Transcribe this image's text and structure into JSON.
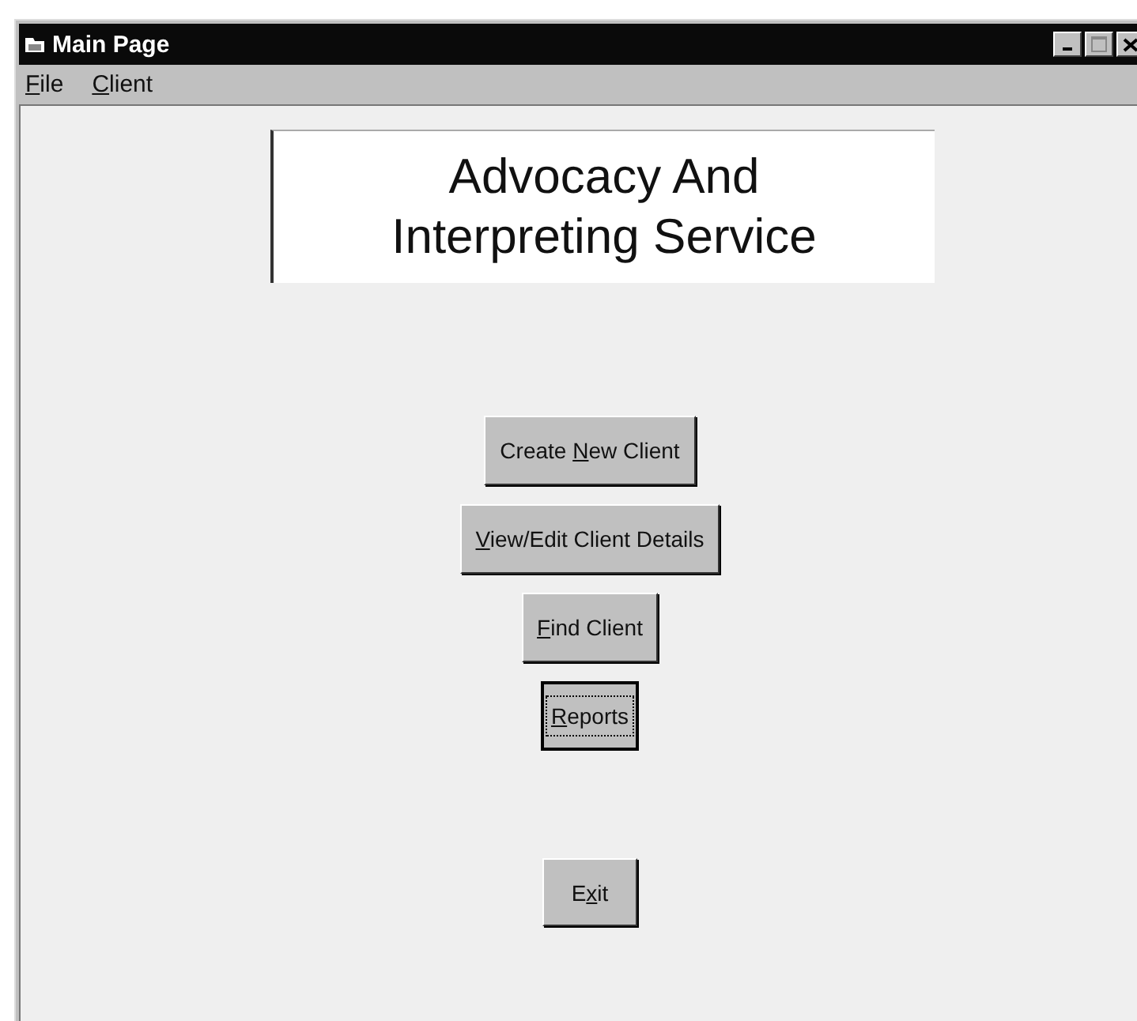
{
  "window": {
    "title": "Main Page"
  },
  "menu": [
    {
      "key": "F",
      "post": "ile"
    },
    {
      "key": "C",
      "post": "lient"
    }
  ],
  "banner": {
    "lines": [
      "Advocacy And",
      "Interpreting Service"
    ]
  },
  "buttons": [
    {
      "pre": "Create ",
      "key": "N",
      "post": "ew Client",
      "focused": false
    },
    {
      "key": "V",
      "post": "iew/Edit Client Details",
      "focused": false
    },
    {
      "key": "F",
      "post": "ind Client",
      "focused": false
    },
    {
      "key": "R",
      "post": "eports",
      "focused": true
    }
  ],
  "exit_button": {
    "pre": "E",
    "key": "x",
    "post": "it",
    "focused": false
  }
}
